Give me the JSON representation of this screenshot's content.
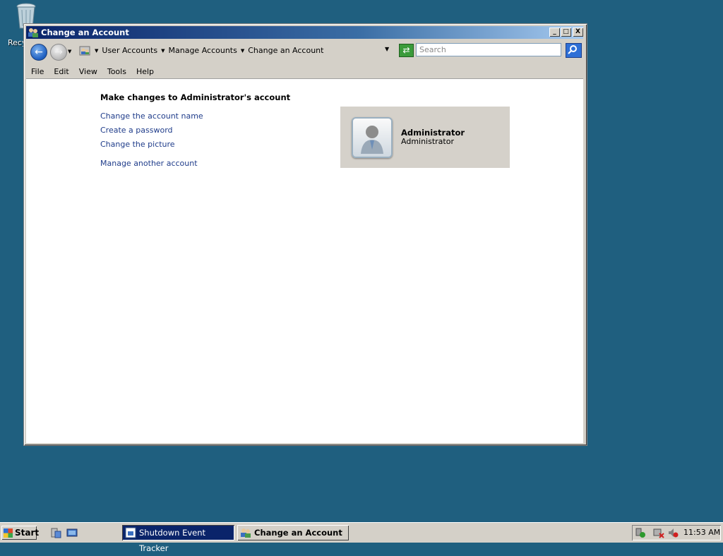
{
  "desktop": {
    "recycle_bin_label": "Recy"
  },
  "window": {
    "title": "Change an Account",
    "controls": {
      "minimize": "_",
      "maximize": "□",
      "close": "X"
    },
    "breadcrumb": [
      "User Accounts",
      "Manage Accounts",
      "Change an Account"
    ],
    "search_placeholder": "Search",
    "menu": [
      "File",
      "Edit",
      "View",
      "Tools",
      "Help"
    ]
  },
  "content": {
    "heading": "Make changes to Administrator's account",
    "links": [
      "Change the account name",
      "Create a password",
      "Change the picture",
      "Manage another account"
    ],
    "account": {
      "name": "Administrator",
      "type": "Administrator"
    }
  },
  "taskbar": {
    "start_label": "Start",
    "tasks": [
      "Shutdown Event Tracker",
      "Change an Account"
    ],
    "clock": "11:53 AM"
  },
  "colors": {
    "desktop": "#1f5f7f",
    "link": "#1f3c8a",
    "titlebar": "#0a246a"
  }
}
